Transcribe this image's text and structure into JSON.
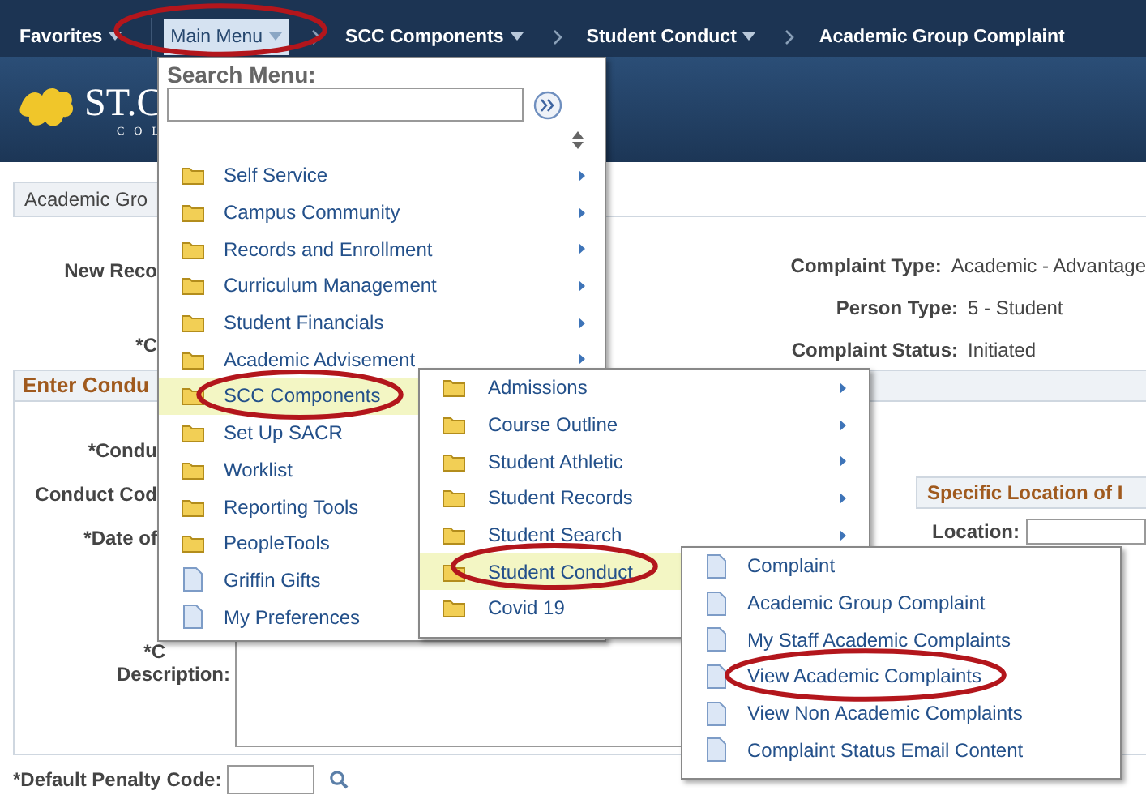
{
  "topbar": {
    "items": [
      {
        "label": "Favorites",
        "dropdown": true,
        "selected": false,
        "circled": false,
        "divider_after": true,
        "chevron_after": false
      },
      {
        "label": "Main Menu",
        "dropdown": true,
        "selected": true,
        "circled": true,
        "divider_after": false,
        "chevron_after": true
      },
      {
        "label": "SCC Components",
        "dropdown": true,
        "selected": false,
        "circled": false,
        "divider_after": false,
        "chevron_after": true
      },
      {
        "label": "Student Conduct",
        "dropdown": true,
        "selected": false,
        "circled": false,
        "divider_after": false,
        "chevron_after": true
      },
      {
        "label": "Academic Group Complaint",
        "dropdown": false,
        "selected": false,
        "circled": false,
        "divider_after": false,
        "chevron_after": false
      }
    ]
  },
  "banner": {
    "logo_text": "ST.C",
    "logo_subtitle": "COL"
  },
  "page_tab": {
    "label": "Academic Gro"
  },
  "header_fields": {
    "left": [
      {
        "label": "New Reco"
      },
      {
        "label": "*C"
      }
    ],
    "right": [
      {
        "label": "Complaint Type:",
        "value": "Academic - Advantage"
      },
      {
        "label": "Person Type:",
        "value": "5 - Student"
      },
      {
        "label": "Complaint Status:",
        "value": "Initiated"
      }
    ]
  },
  "conduct_section": {
    "title": "Enter Condu",
    "fields": [
      {
        "label": "*Condu"
      },
      {
        "label": "Conduct Cod"
      },
      {
        "label": "*Date of"
      }
    ],
    "description": {
      "label_top": "*C",
      "label": "Description:"
    },
    "location_panel": {
      "title": "Specific Location of I",
      "label": "Location:"
    }
  },
  "penalty": {
    "label": "*Default Penalty Code:"
  },
  "main_menu": {
    "search_label": "Search Menu:",
    "items": [
      {
        "label": "Self Service",
        "kind": "folder",
        "has_submenu": true,
        "selected": false,
        "circled": false
      },
      {
        "label": "Campus Community",
        "kind": "folder",
        "has_submenu": true,
        "selected": false,
        "circled": false
      },
      {
        "label": "Records and Enrollment",
        "kind": "folder",
        "has_submenu": true,
        "selected": false,
        "circled": false
      },
      {
        "label": "Curriculum Management",
        "kind": "folder",
        "has_submenu": true,
        "selected": false,
        "circled": false
      },
      {
        "label": "Student Financials",
        "kind": "folder",
        "has_submenu": true,
        "selected": false,
        "circled": false
      },
      {
        "label": "Academic Advisement",
        "kind": "folder",
        "has_submenu": true,
        "selected": false,
        "circled": false
      },
      {
        "label": "SCC Components",
        "kind": "folder",
        "has_submenu": false,
        "selected": true,
        "circled": true
      },
      {
        "label": "Set Up SACR",
        "kind": "folder",
        "has_submenu": false,
        "selected": false,
        "circled": false
      },
      {
        "label": "Worklist",
        "kind": "folder",
        "has_submenu": false,
        "selected": false,
        "circled": false
      },
      {
        "label": "Reporting Tools",
        "kind": "folder",
        "has_submenu": false,
        "selected": false,
        "circled": false
      },
      {
        "label": "PeopleTools",
        "kind": "folder",
        "has_submenu": false,
        "selected": false,
        "circled": false
      },
      {
        "label": "Griffin Gifts",
        "kind": "page",
        "has_submenu": false,
        "selected": false,
        "circled": false
      },
      {
        "label": "My Preferences",
        "kind": "page",
        "has_submenu": false,
        "selected": false,
        "circled": false
      }
    ]
  },
  "submenu": {
    "items": [
      {
        "label": "Admissions",
        "kind": "folder",
        "has_submenu": true,
        "selected": false,
        "circled": false
      },
      {
        "label": "Course Outline",
        "kind": "folder",
        "has_submenu": true,
        "selected": false,
        "circled": false
      },
      {
        "label": "Student Athletic",
        "kind": "folder",
        "has_submenu": true,
        "selected": false,
        "circled": false
      },
      {
        "label": "Student Records",
        "kind": "folder",
        "has_submenu": true,
        "selected": false,
        "circled": false
      },
      {
        "label": "Student Search",
        "kind": "folder",
        "has_submenu": true,
        "selected": false,
        "circled": false
      },
      {
        "label": "Student Conduct",
        "kind": "folder",
        "has_submenu": false,
        "selected": true,
        "circled": true
      },
      {
        "label": "Covid 19",
        "kind": "folder",
        "has_submenu": false,
        "selected": false,
        "circled": false
      }
    ]
  },
  "subsubmenu": {
    "items": [
      {
        "label": "Complaint",
        "kind": "page",
        "has_submenu": false,
        "selected": false,
        "circled": false
      },
      {
        "label": "Academic Group Complaint",
        "kind": "page",
        "has_submenu": false,
        "selected": false,
        "circled": false
      },
      {
        "label": "My Staff Academic Complaints",
        "kind": "page",
        "has_submenu": false,
        "selected": false,
        "circled": false
      },
      {
        "label": "View Academic Complaints",
        "kind": "page",
        "has_submenu": false,
        "selected": false,
        "circled": true
      },
      {
        "label": "View Non Academic Complaints",
        "kind": "page",
        "has_submenu": false,
        "selected": false,
        "circled": false
      },
      {
        "label": "Complaint Status Email Content",
        "kind": "page",
        "has_submenu": false,
        "selected": false,
        "circled": false
      }
    ]
  }
}
